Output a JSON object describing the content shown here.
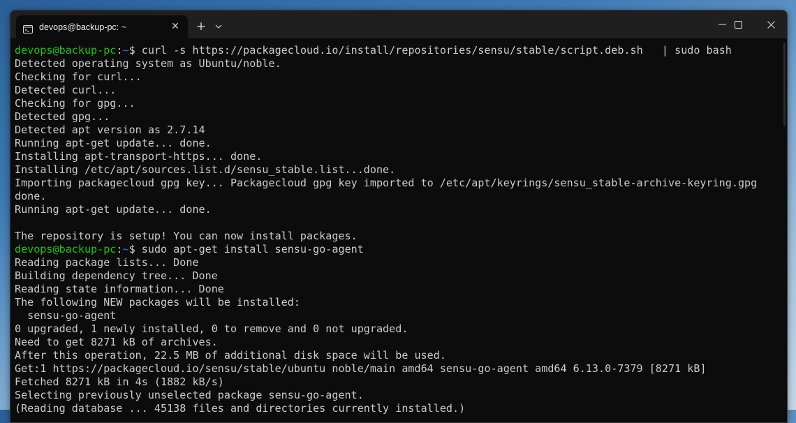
{
  "window": {
    "tab_title": "devops@backup-pc: ~",
    "tab_icon": "terminal-icon",
    "new_tab_symbol": "+",
    "close_symbol": "✕"
  },
  "terminal": {
    "prompt_user": "devops@backup-pc",
    "prompt_path": "~",
    "prompt_symbol": "$ ",
    "colors": {
      "background": "#0c0c0c",
      "text": "#cccccc",
      "prompt_user": "#16c60c",
      "prompt_path": "#3b78ff"
    },
    "lines": [
      {
        "type": "prompt",
        "cmd": "curl -s https://packagecloud.io/install/repositories/sensu/stable/script.deb.sh   | sudo bash"
      },
      {
        "type": "out",
        "text": "Detected operating system as Ubuntu/noble."
      },
      {
        "type": "out",
        "text": "Checking for curl..."
      },
      {
        "type": "out",
        "text": "Detected curl..."
      },
      {
        "type": "out",
        "text": "Checking for gpg..."
      },
      {
        "type": "out",
        "text": "Detected gpg..."
      },
      {
        "type": "out",
        "text": "Detected apt version as 2.7.14"
      },
      {
        "type": "out",
        "text": "Running apt-get update... done."
      },
      {
        "type": "out",
        "text": "Installing apt-transport-https... done."
      },
      {
        "type": "out",
        "text": "Installing /etc/apt/sources.list.d/sensu_stable.list...done."
      },
      {
        "type": "out",
        "text": "Importing packagecloud gpg key... Packagecloud gpg key imported to /etc/apt/keyrings/sensu_stable-archive-keyring.gpg"
      },
      {
        "type": "out",
        "text": "done."
      },
      {
        "type": "out",
        "text": "Running apt-get update... done."
      },
      {
        "type": "out",
        "text": ""
      },
      {
        "type": "out",
        "text": "The repository is setup! You can now install packages."
      },
      {
        "type": "prompt",
        "cmd": "sudo apt-get install sensu-go-agent"
      },
      {
        "type": "out",
        "text": "Reading package lists... Done"
      },
      {
        "type": "out",
        "text": "Building dependency tree... Done"
      },
      {
        "type": "out",
        "text": "Reading state information... Done"
      },
      {
        "type": "out",
        "text": "The following NEW packages will be installed:"
      },
      {
        "type": "out",
        "text": "  sensu-go-agent"
      },
      {
        "type": "out",
        "text": "0 upgraded, 1 newly installed, 0 to remove and 0 not upgraded."
      },
      {
        "type": "out",
        "text": "Need to get 8271 kB of archives."
      },
      {
        "type": "out",
        "text": "After this operation, 22.5 MB of additional disk space will be used."
      },
      {
        "type": "out",
        "text": "Get:1 https://packagecloud.io/sensu/stable/ubuntu noble/main amd64 sensu-go-agent amd64 6.13.0-7379 [8271 kB]"
      },
      {
        "type": "out",
        "text": "Fetched 8271 kB in 4s (1882 kB/s)"
      },
      {
        "type": "out",
        "text": "Selecting previously unselected package sensu-go-agent."
      },
      {
        "type": "out",
        "text": "(Reading database ... 45138 files and directories currently installed.)"
      }
    ]
  }
}
